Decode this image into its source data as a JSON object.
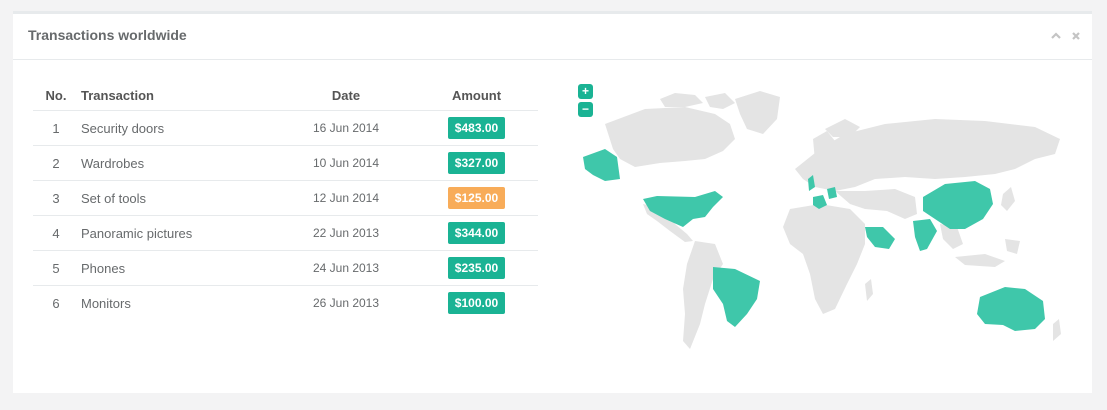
{
  "panel": {
    "title": "Transactions worldwide",
    "collapse_icon": "chevron-up-icon",
    "close_icon": "close-icon"
  },
  "table": {
    "headers": {
      "no": "No.",
      "transaction": "Transaction",
      "date": "Date",
      "amount": "Amount"
    },
    "rows": [
      {
        "no": "1",
        "transaction": "Security doors",
        "date": "16 Jun 2014",
        "amount": "$483.00",
        "status": "primary"
      },
      {
        "no": "2",
        "transaction": "Wardrobes",
        "date": "10 Jun 2014",
        "amount": "$327.00",
        "status": "primary"
      },
      {
        "no": "3",
        "transaction": "Set of tools",
        "date": "12 Jun 2014",
        "amount": "$125.00",
        "status": "warning"
      },
      {
        "no": "4",
        "transaction": "Panoramic pictures",
        "date": "22 Jun 2013",
        "amount": "$344.00",
        "status": "primary"
      },
      {
        "no": "5",
        "transaction": "Phones",
        "date": "24 Jun 2013",
        "amount": "$235.00",
        "status": "primary"
      },
      {
        "no": "6",
        "transaction": "Monitors",
        "date": "26 Jun 2013",
        "amount": "$100.00",
        "status": "primary"
      }
    ]
  },
  "map": {
    "zoom_in": "+",
    "zoom_out": "−",
    "highlighted_regions": [
      "Alaska",
      "United States",
      "Brazil",
      "United Kingdom",
      "France",
      "Germany",
      "Saudi Arabia",
      "India",
      "China",
      "Australia"
    ]
  },
  "colors": {
    "primary": "#1ab394",
    "warning": "#f8ac59",
    "map_land": "#e4e4e4",
    "map_highlight": "#3fc7aa"
  }
}
